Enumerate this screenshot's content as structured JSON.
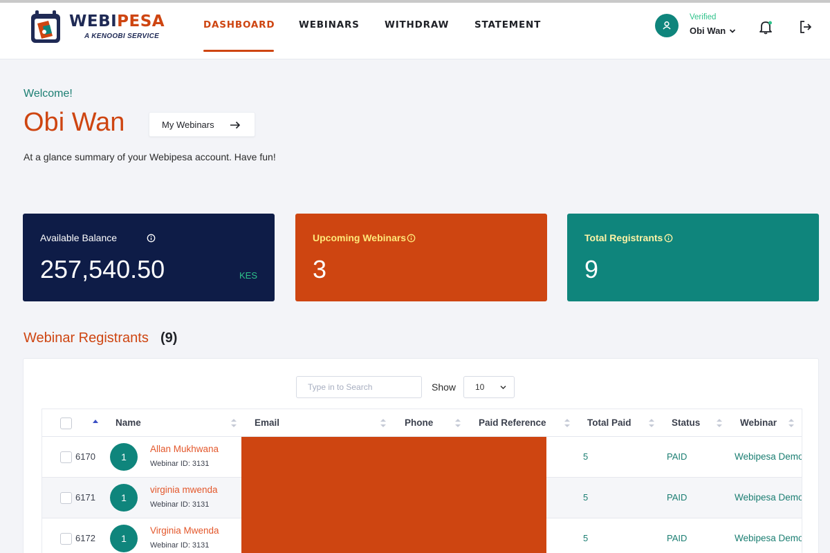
{
  "brand": {
    "name_part1": "WEBI",
    "name_part2": "PESA",
    "tagline": "A KENOOBI SERVICE"
  },
  "nav": {
    "items": [
      {
        "label": "DASHBOARD",
        "active": true
      },
      {
        "label": "WEBINARS",
        "active": false
      },
      {
        "label": "WITHDRAW",
        "active": false
      },
      {
        "label": "STATEMENT",
        "active": false
      }
    ]
  },
  "user": {
    "status": "Verified",
    "name": "Obi Wan"
  },
  "hero": {
    "welcome": "Welcome!",
    "name": "Obi Wan",
    "my_webinars_label": "My Webinars",
    "summary": "At a glance summary of your Webipesa account. Have fun!"
  },
  "cards": [
    {
      "title": "Available Balance",
      "value": "257,540.50",
      "currency": "KES",
      "bg": "#0e1c47"
    },
    {
      "title": "Upcoming Webinars",
      "value": "3",
      "bg": "#ce4511"
    },
    {
      "title": "Total Registrants",
      "value": "9",
      "bg": "#0f857c"
    }
  ],
  "registrants": {
    "title": "Webinar Registrants",
    "count": "(9)",
    "search_placeholder": "Type in to Search",
    "show_label": "Show",
    "show_value": "10",
    "columns": [
      "Name",
      "Email",
      "Phone",
      "Paid Reference",
      "Total Paid",
      "Status",
      "Webinar"
    ],
    "rows": [
      {
        "id": "6170",
        "avatar": "1",
        "name": "Allan Mukhwana",
        "webinar_id": "Webinar ID: 3131",
        "total_paid": "5",
        "status": "PAID",
        "webinar": "Webipesa Demo"
      },
      {
        "id": "6171",
        "avatar": "1",
        "name": "virginia mwenda",
        "webinar_id": "Webinar ID: 3131",
        "total_paid": "5",
        "status": "PAID",
        "webinar": "Webipesa Demo"
      },
      {
        "id": "6172",
        "avatar": "1",
        "name": "Virginia Mwenda",
        "webinar_id": "Webinar ID: 3131",
        "total_paid": "5",
        "status": "PAID",
        "webinar": "Webipesa Demo"
      }
    ]
  },
  "colors": {
    "accent": "#ce4511",
    "navy": "#0e1c47",
    "teal": "#0f857c",
    "verified": "#2ec28a"
  },
  "icons": [
    "logo-icon",
    "user-icon",
    "chevron-down-icon",
    "bell-icon",
    "logout-icon",
    "arrow-right-icon",
    "info-icon",
    "sort-icon",
    "sort-asc-icon"
  ]
}
